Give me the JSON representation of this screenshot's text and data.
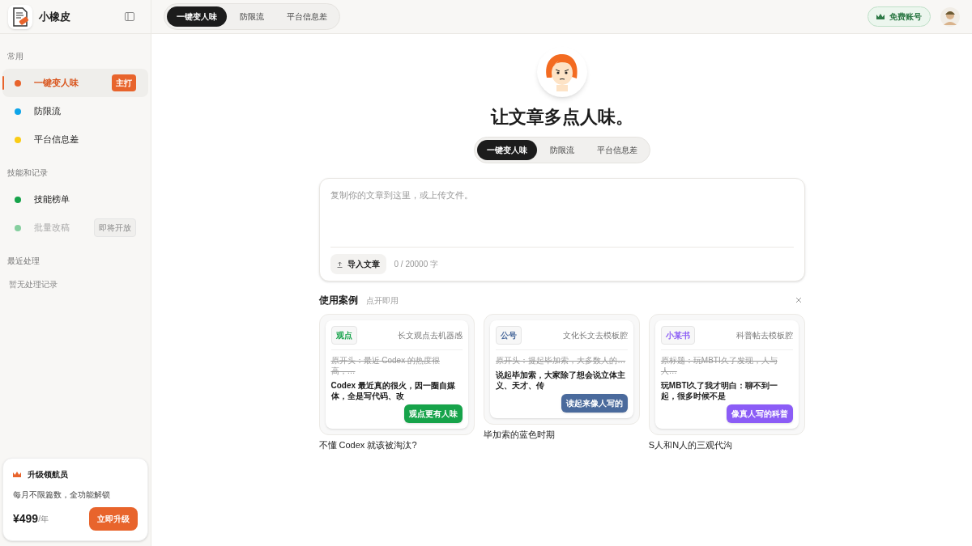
{
  "app": {
    "name": "小橡皮"
  },
  "sidebar": {
    "sections": [
      {
        "title": "常用",
        "items": [
          {
            "label": "一键变人味",
            "color": "#e8642c",
            "selected": true,
            "disabled": false,
            "badge": "主打"
          },
          {
            "label": "防限流",
            "color": "#0ea5e9",
            "selected": false,
            "disabled": false
          },
          {
            "label": "平台信息差",
            "color": "#facc15",
            "selected": false,
            "disabled": false
          }
        ]
      },
      {
        "title": "技能和记录",
        "items": [
          {
            "label": "技能榜单",
            "color": "#16a34a",
            "selected": false,
            "disabled": false
          },
          {
            "label": "批量改稿",
            "color": "#86cf9f",
            "selected": false,
            "disabled": true,
            "badge": "即将开放"
          }
        ]
      },
      {
        "title": "最近处理",
        "empty": "暂无处理记录"
      }
    ],
    "promo": {
      "title": "升级领航员",
      "text": "每月不限篇数，全功能解锁",
      "price": "¥499",
      "unit": "/年",
      "button": "立即升级"
    }
  },
  "top_tabs": [
    {
      "label": "一键变人味",
      "selected": true
    },
    {
      "label": "防限流",
      "selected": false
    },
    {
      "label": "平台信息差",
      "selected": false
    }
  ],
  "account_button": "免费账号",
  "hero": {
    "title": "让文章多点人味。",
    "tabs": [
      {
        "label": "一键变人味",
        "selected": true
      },
      {
        "label": "防限流",
        "selected": false
      },
      {
        "label": "平台信息差",
        "selected": false
      }
    ]
  },
  "editor": {
    "placeholder": "复制你的文章到这里，或上传文件。",
    "import_button": "导入文章",
    "counter": "0 / 20000 字"
  },
  "cases": {
    "title": "使用案例",
    "hint": "点开即用",
    "items": [
      {
        "tag": "观点",
        "color": "#16a34a",
        "label": "长文观点去机器感",
        "original": "原开头：最近 Codex 的热度很高，…",
        "rewrite": "Codex 最近真的很火，因一圈自媒体，全是写代码、改",
        "action": "观点更有人味",
        "caption": "不懂 Codex 就该被淘汰?"
      },
      {
        "tag": "公号",
        "color": "#4a6a9c",
        "label": "文化长文去模板腔",
        "original": "原开头：提起毕加索，大多数人的…",
        "rewrite": "说起毕加索，大家除了想会说立体主义、天才、传",
        "action": "读起来像人写的",
        "caption": "毕加索的蓝色时期"
      },
      {
        "tag": "小某书",
        "color": "#8b5cf6",
        "label": "科普帖去模板腔",
        "original": "原标题：玩MBTI久了发现，人与人…",
        "rewrite": "玩MBTI久了我才明白：聊不到一起，很多时候不是",
        "action": "像真人写的科普",
        "caption": "S人和N人的三观代沟"
      }
    ]
  }
}
